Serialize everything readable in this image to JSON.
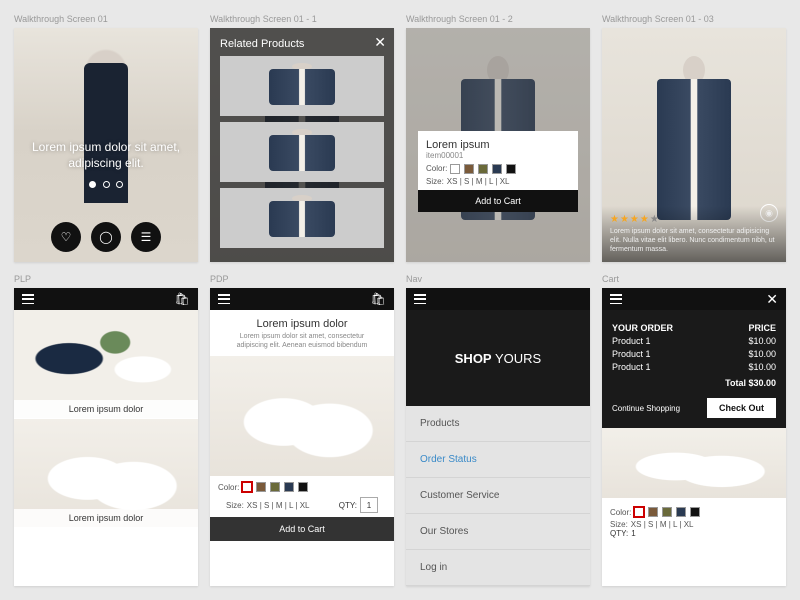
{
  "labels": {
    "w1": "Walkthrough Screen 01",
    "w2": "Walkthrough Screen 01 - 1",
    "w3": "Walkthrough Screen 01 - 2",
    "w4": "Walkthrough Screen 01 - 03",
    "plp": "PLP",
    "pdp": "PDP",
    "nav": "Nav",
    "cart": "Cart"
  },
  "walkthrough": {
    "caption": "Lorem ipsum dolor sit amet, adipiscing elit."
  },
  "related": {
    "title": "Related Products"
  },
  "product_card": {
    "name": "Lorem ipsum",
    "sku": "item00001",
    "color_label": "Color:",
    "size_label": "Size:",
    "sizes": "XS | S | M | L | XL",
    "add": "Add to Cart"
  },
  "detail": {
    "desc": "Lorem ipsum dolor sit amet, consectetur adipisicing elit. Nulla vitae elit libero. Nunc condimentum nibh, ut fermentum massa."
  },
  "plp": {
    "cap1": "Lorem ipsum dolor",
    "cap2": "Lorem ipsum dolor"
  },
  "pdp": {
    "title": "Lorem ipsum dolor",
    "sub": "Lorem ipsum dolor sit amet, consectetur adipiscing elit. Aenean euismod bibendum",
    "color_label": "Color:",
    "size_label": "Size:",
    "sizes": "XS | S | M | L | XL",
    "qty_label": "QTY:",
    "qty": "1",
    "add": "Add to Cart"
  },
  "nav": {
    "brand1": "SHOP ",
    "brand2": "YOURS",
    "items": [
      "Products",
      "Order Status",
      "Customer Service",
      "Our Stores",
      "Log in"
    ]
  },
  "cart": {
    "order_hdr": "YOUR ORDER",
    "price_hdr": "PRICE",
    "lines": [
      {
        "name": "Product 1",
        "price": "$10.00"
      },
      {
        "name": "Product 1",
        "price": "$10.00"
      },
      {
        "name": "Product 1",
        "price": "$10.00"
      }
    ],
    "total": "Total $30.00",
    "continue": "Continue Shopping",
    "checkout": "Check Out",
    "color_label": "Color:",
    "size_label": "Size:",
    "sizes": "XS | S | M | L | XL",
    "qty_label": "QTY:",
    "qty": "1"
  }
}
